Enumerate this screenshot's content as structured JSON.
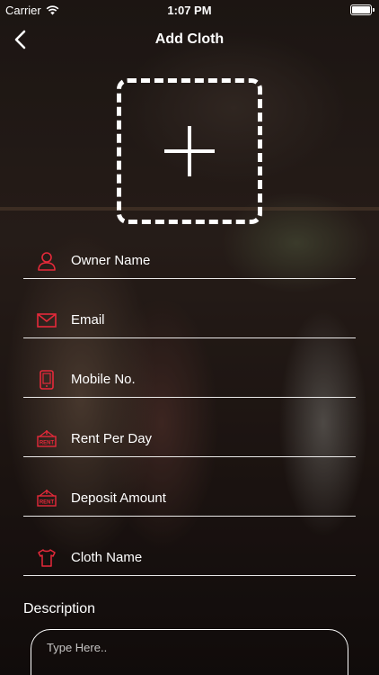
{
  "statusbar": {
    "carrier": "Carrier",
    "time": "1:07 PM"
  },
  "navbar": {
    "title": "Add Cloth"
  },
  "form": {
    "fields": [
      {
        "label": "Owner Name",
        "icon": "person-icon"
      },
      {
        "label": "Email",
        "icon": "mail-icon"
      },
      {
        "label": "Mobile No.",
        "icon": "mobile-icon"
      },
      {
        "label": "Rent Per Day",
        "icon": "rent-tag-icon"
      },
      {
        "label": "Deposit Amount",
        "icon": "rent-tag-icon"
      },
      {
        "label": "Cloth Name",
        "icon": "shirt-icon"
      }
    ],
    "description_label": "Description",
    "description_placeholder": "Type Here.."
  },
  "icon_text": {
    "rent": "RENT"
  },
  "colors": {
    "accent": "#e5293a",
    "text": "#ffffff"
  }
}
